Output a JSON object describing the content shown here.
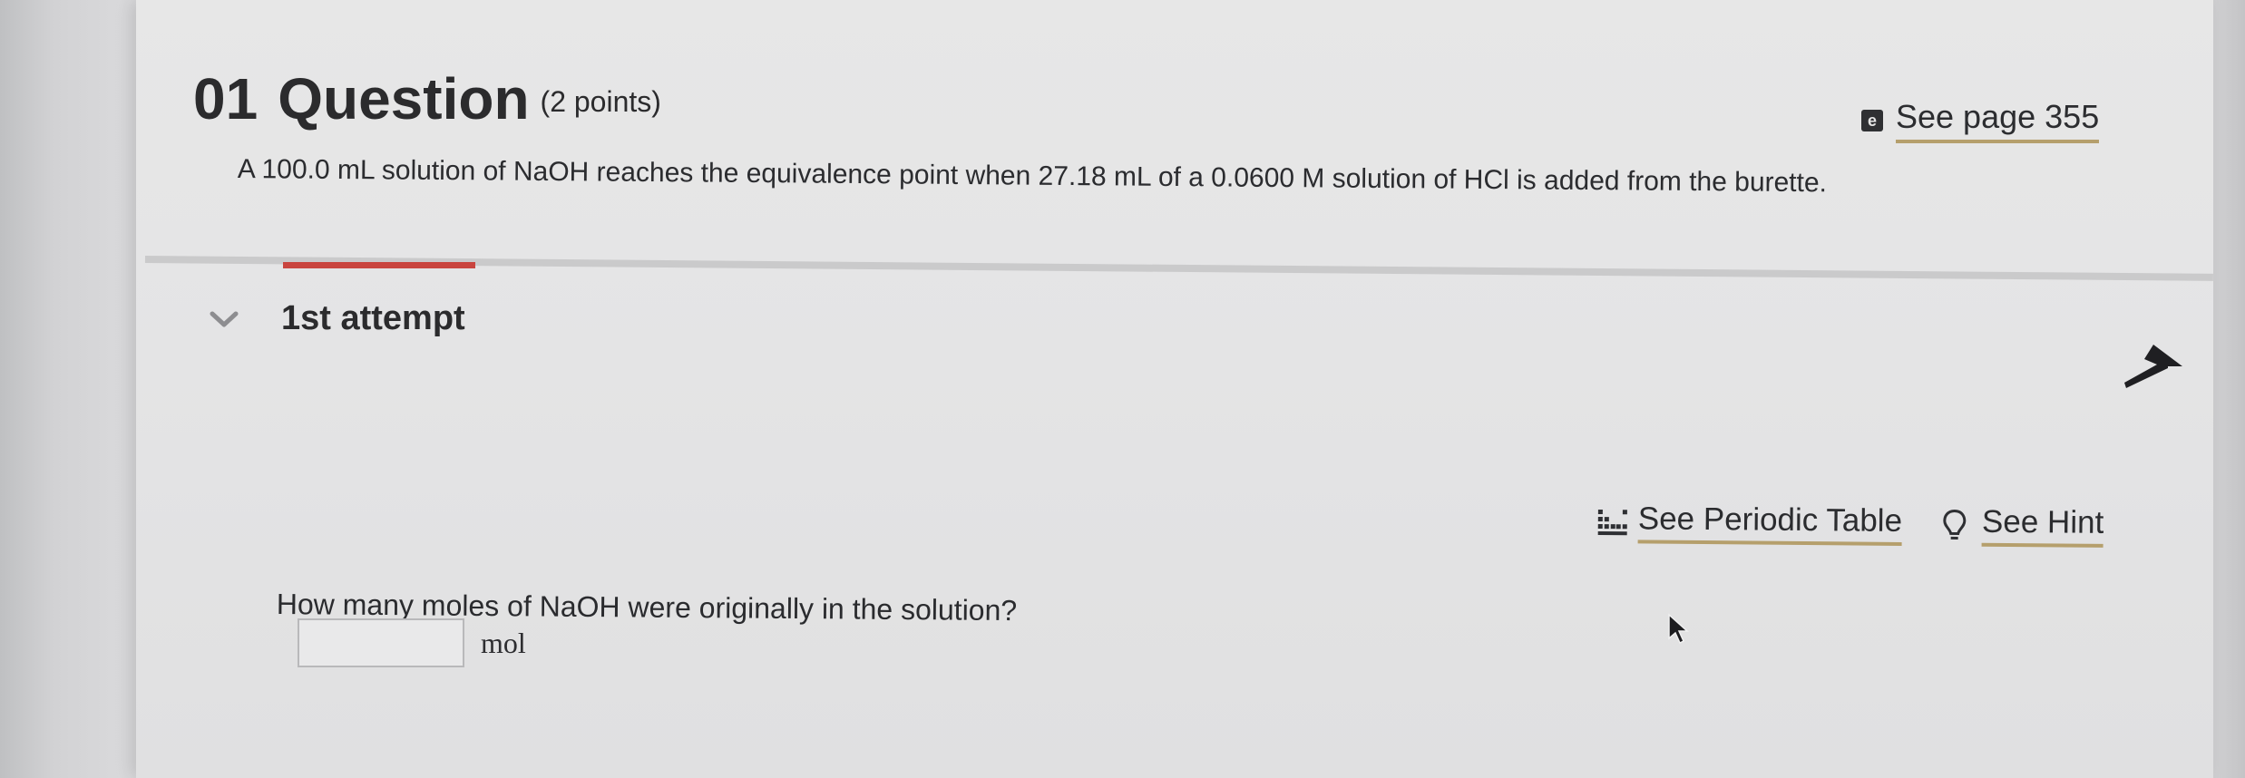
{
  "question": {
    "number": "01",
    "label": "Question",
    "points": "(2 points)",
    "page_reference": "See page 355",
    "prompt": "A 100.0 mL solution of NaOH reaches the equivalence point when 27.18 mL of a 0.0600 M solution of HCl is added from the burette."
  },
  "attempt": {
    "label": "1st attempt"
  },
  "tools": {
    "periodic_table": "See Periodic Table",
    "hint": "See Hint"
  },
  "sub_question": {
    "text": "How many moles of NaOH were originally in the solution?",
    "answer_value": "",
    "unit": "mol"
  },
  "icons": {
    "ebook": "e",
    "chevron": "chevron-down-icon",
    "up_arrow": "up-arrow-icon",
    "periodic": "periodic-table-icon",
    "hint": "lightbulb-icon",
    "cursor": "mouse-pointer-icon"
  },
  "colors": {
    "accent_underline": "#b59f6c",
    "progress_red": "#c9453f",
    "text": "#2b2b2d"
  }
}
